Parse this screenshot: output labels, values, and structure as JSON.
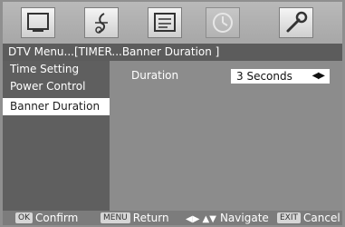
{
  "icons": [
    {
      "name": "picture-icon",
      "active": false
    },
    {
      "name": "audio-note-icon",
      "active": false
    },
    {
      "name": "setup-icon",
      "active": false
    },
    {
      "name": "clock-icon",
      "active": true
    },
    {
      "name": "wrench-icon",
      "active": false
    }
  ],
  "header": {
    "breadcrumb": "DTV Menu...[TIMER...Banner Duration ]"
  },
  "left_menu": {
    "items": [
      {
        "label": "Time Setting",
        "selected": false
      },
      {
        "label": "Power Control",
        "selected": false
      },
      {
        "label": "Banner Duration",
        "selected": true
      }
    ]
  },
  "panel": {
    "duration_label": "Duration",
    "duration_value": "3 Seconds",
    "arrows_icon": "◀▶"
  },
  "footer": {
    "ok_key": "OK",
    "ok_label": "Confirm",
    "menu_key": "MENU",
    "menu_label": "Return",
    "nav_icon": "◀▶ ▲▼",
    "nav_label": "Navigate",
    "exit_key": "EXIT",
    "exit_label": "Cancel"
  },
  "colors": {
    "header_bg": "#5c5c5c",
    "menu_bg": "#5f5f5f",
    "panel_bg": "#8c8c8c",
    "selected_bg": "#ffffff"
  }
}
